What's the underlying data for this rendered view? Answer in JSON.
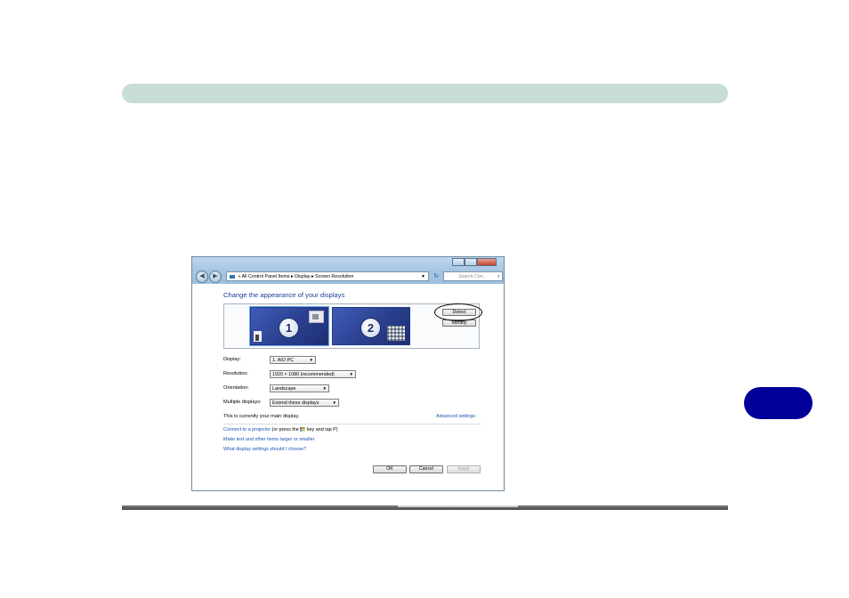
{
  "window": {
    "address_path": [
      "«",
      "All Control Panel Items",
      "▸",
      "Display",
      "▸",
      "Screen Resolution"
    ],
    "search_placeholder": "Search Con...",
    "heading": "Change the appearance of your displays",
    "monitors": [
      {
        "number": "1",
        "selected": true
      },
      {
        "number": "2",
        "selected": false
      }
    ],
    "buttons": {
      "detect": "Detect",
      "identify": "Identify",
      "ok": "OK",
      "cancel": "Cancel",
      "apply": "Apply"
    },
    "fields": {
      "display": {
        "label": "Display:",
        "value": "1. AIO PC"
      },
      "resolution": {
        "label": "Resolution:",
        "value": "1920 × 1080 (recommended)"
      },
      "orientation": {
        "label": "Orientation:",
        "value": "Landscape"
      },
      "multiple_displays": {
        "label": "Multiple displays:",
        "value": "Extend these displays"
      }
    },
    "status_text": "This is currently your main display.",
    "advanced_link": "Advanced settings",
    "projector_link": "Connect to a projector",
    "projector_hint_pre": "(or press the",
    "projector_hint_post": "key and tap P)",
    "text_size_link": "Make text and other items larger or smaller",
    "help_link": "What display settings should I choose?"
  },
  "colors": {
    "top_band": "#c8dcd8",
    "side_tab": "#000099",
    "link": "#1e50b8",
    "heading": "#1e3f9a"
  }
}
